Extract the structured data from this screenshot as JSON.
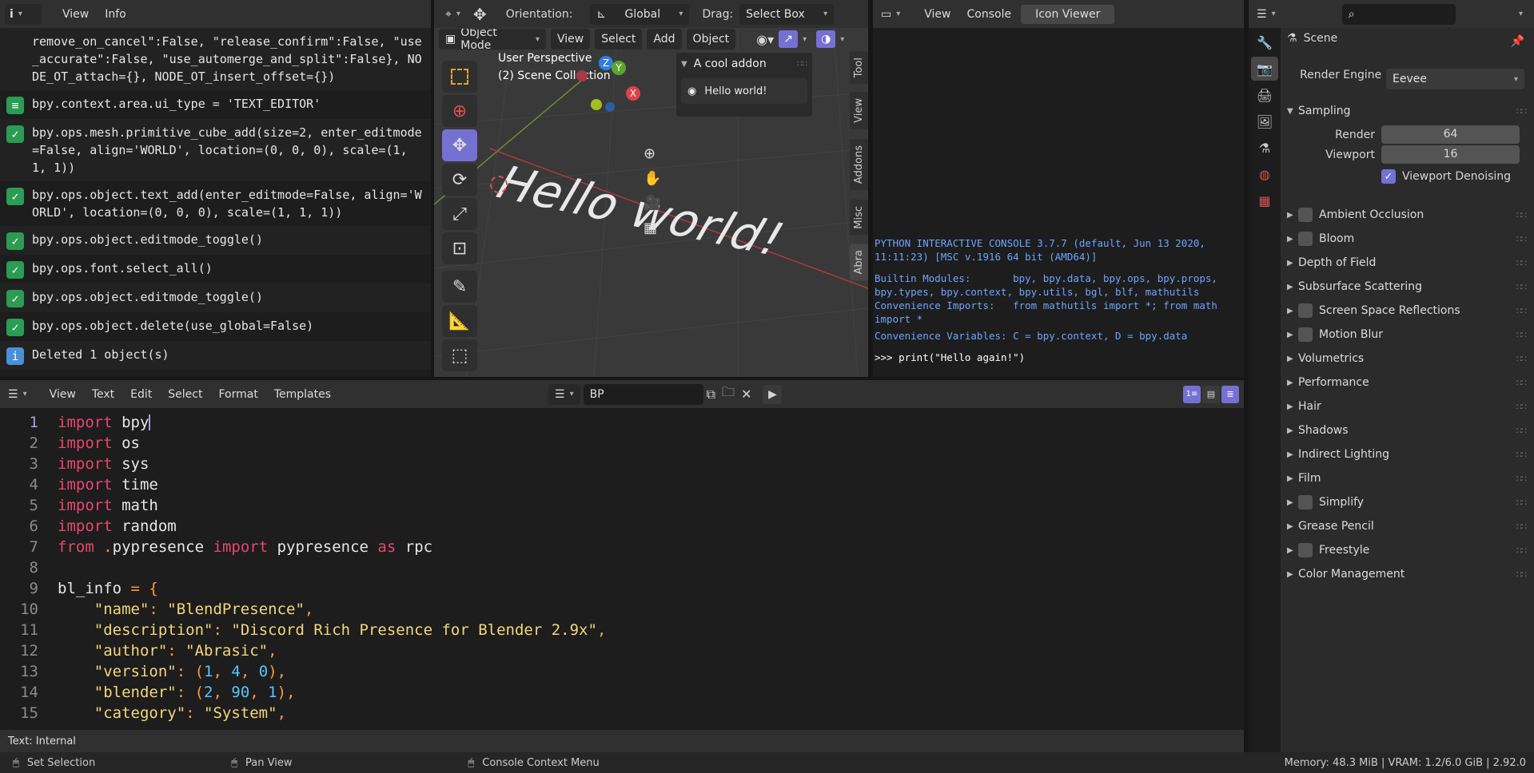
{
  "info": {
    "menus": [
      "View",
      "Info"
    ],
    "entries": [
      {
        "badge": "",
        "text": "remove_on_cancel\":False, \"release_confirm\":False, \"use_accurate\":False, \"use_automerge_and_split\":False}, NODE_OT_attach={}, NODE_OT_insert_offset={})"
      },
      {
        "badge": "props",
        "text": "bpy.context.area.ui_type = 'TEXT_EDITOR'"
      },
      {
        "badge": "op",
        "text": "bpy.ops.mesh.primitive_cube_add(size=2, enter_editmode=False, align='WORLD', location=(0, 0, 0), scale=(1, 1, 1))"
      },
      {
        "badge": "op",
        "text": "bpy.ops.object.text_add(enter_editmode=False, align='WORLD', location=(0, 0, 0), scale=(1, 1, 1))"
      },
      {
        "badge": "op",
        "text": "bpy.ops.object.editmode_toggle()"
      },
      {
        "badge": "op",
        "text": "bpy.ops.font.select_all()"
      },
      {
        "badge": "op",
        "text": "bpy.ops.object.editmode_toggle()"
      },
      {
        "badge": "op",
        "text": "bpy.ops.object.delete(use_global=False)"
      },
      {
        "badge": "info",
        "text": "Deleted 1 object(s)"
      }
    ]
  },
  "viewport": {
    "orientation_label": "Orientation:",
    "orientation_value": "Global",
    "drag_label": "Drag:",
    "drag_value": "Select Box",
    "mode": "Object Mode",
    "menus": [
      "View",
      "Select",
      "Add",
      "Object"
    ],
    "overlay_title": "User Perspective",
    "overlay_sub": "(2) Scene Collection",
    "scene_text": "Hello world!",
    "addon_panel": {
      "title": "A cool addon",
      "button": "Hello world!"
    },
    "side_tabs": [
      "Tool",
      "View",
      "Addons",
      "Misc",
      "Abra"
    ],
    "gizmo": {
      "x": "X",
      "y": "Y",
      "z": "Z"
    }
  },
  "console": {
    "menus": [
      "View",
      "Console",
      "Icon Viewer"
    ],
    "banner": "PYTHON INTERACTIVE CONSOLE 3.7.7 (default, Jun 13 2020, 11:11:23) [MSC v.1916 64 bit (AMD64)]",
    "builtin": "Builtin Modules:       bpy, bpy.data, bpy.ops, bpy.props, bpy.types, bpy.context, bpy.utils, bgl, blf, mathutils",
    "imports": "Convenience Imports:   from mathutils import *; from math import *",
    "vars": "Convenience Variables: C = bpy.context, D = bpy.data",
    "prompt": ">>> print(\"Hello again!\")"
  },
  "properties": {
    "search_placeholder": "",
    "scene_label": "Scene",
    "render_engine_label": "Render Engine",
    "render_engine_value": "Eevee",
    "sampling": "Sampling",
    "render_label": "Render",
    "render_value": "64",
    "viewport_label": "Viewport",
    "viewport_value": "16",
    "denoise": "Viewport Denoising",
    "panels": [
      {
        "label": "Ambient Occlusion",
        "check": true
      },
      {
        "label": "Bloom",
        "check": true
      },
      {
        "label": "Depth of Field",
        "check": false
      },
      {
        "label": "Subsurface Scattering",
        "check": false
      },
      {
        "label": "Screen Space Reflections",
        "check": true
      },
      {
        "label": "Motion Blur",
        "check": true
      },
      {
        "label": "Volumetrics",
        "check": false
      },
      {
        "label": "Performance",
        "check": false
      },
      {
        "label": "Hair",
        "check": false
      },
      {
        "label": "Shadows",
        "check": false
      },
      {
        "label": "Indirect Lighting",
        "check": false
      },
      {
        "label": "Film",
        "check": false
      },
      {
        "label": "Simplify",
        "check": true
      },
      {
        "label": "Grease Pencil",
        "check": false
      },
      {
        "label": "Freestyle",
        "check": true
      },
      {
        "label": "Color Management",
        "check": false
      }
    ]
  },
  "text_editor": {
    "menus": [
      "View",
      "Text",
      "Edit",
      "Select",
      "Format",
      "Templates"
    ],
    "text_name": "BP",
    "footer": "Text: Internal",
    "lines": [
      [
        [
          "kw",
          "import"
        ],
        [
          "df",
          " bpy"
        ]
      ],
      [
        [
          "kw",
          "import"
        ],
        [
          "df",
          " os"
        ]
      ],
      [
        [
          "kw",
          "import"
        ],
        [
          "df",
          " sys"
        ]
      ],
      [
        [
          "kw",
          "import"
        ],
        [
          "df",
          " time"
        ]
      ],
      [
        [
          "kw",
          "import"
        ],
        [
          "df",
          " math"
        ]
      ],
      [
        [
          "kw",
          "import"
        ],
        [
          "df",
          " random"
        ]
      ],
      [
        [
          "kw",
          "from"
        ],
        [
          "op",
          " ."
        ],
        [
          "df",
          "pypresence "
        ],
        [
          "kw",
          "import"
        ],
        [
          "df",
          " pypresence "
        ],
        [
          "kw",
          "as"
        ],
        [
          "df",
          " rpc"
        ]
      ],
      [
        [
          "df",
          ""
        ]
      ],
      [
        [
          "df",
          "bl_info "
        ],
        [
          "op",
          "="
        ],
        [
          "op",
          " {"
        ]
      ],
      [
        [
          "df",
          "    "
        ],
        [
          "st",
          "\"name\""
        ],
        [
          "op",
          ":"
        ],
        [
          "st",
          " \"BlendPresence\""
        ],
        [
          "op",
          ","
        ]
      ],
      [
        [
          "df",
          "    "
        ],
        [
          "st",
          "\"description\""
        ],
        [
          "op",
          ":"
        ],
        [
          "st",
          " \"Discord Rich Presence for Blender 2.9x\""
        ],
        [
          "op",
          ","
        ]
      ],
      [
        [
          "df",
          "    "
        ],
        [
          "st",
          "\"author\""
        ],
        [
          "op",
          ":"
        ],
        [
          "st",
          " \"Abrasic\""
        ],
        [
          "op",
          ","
        ]
      ],
      [
        [
          "df",
          "    "
        ],
        [
          "st",
          "\"version\""
        ],
        [
          "op",
          ": ("
        ],
        [
          "nm",
          "1"
        ],
        [
          "op",
          ", "
        ],
        [
          "nm",
          "4"
        ],
        [
          "op",
          ", "
        ],
        [
          "nm",
          "0"
        ],
        [
          "op",
          "),"
        ]
      ],
      [
        [
          "df",
          "    "
        ],
        [
          "st",
          "\"blender\""
        ],
        [
          "op",
          ": ("
        ],
        [
          "nm",
          "2"
        ],
        [
          "op",
          ", "
        ],
        [
          "nm",
          "90"
        ],
        [
          "op",
          ", "
        ],
        [
          "nm",
          "1"
        ],
        [
          "op",
          "),"
        ]
      ],
      [
        [
          "df",
          "    "
        ],
        [
          "st",
          "\"category\""
        ],
        [
          "op",
          ":"
        ],
        [
          "st",
          " \"System\""
        ],
        [
          "op",
          ","
        ]
      ],
      [
        [
          "op",
          "}"
        ]
      ]
    ]
  },
  "status": {
    "left": "Set Selection",
    "mid": "Pan View",
    "right": "Console Context Menu",
    "memory": "Memory: 48.3 MiB | VRAM: 1.2/6.0 GiB | 2.92.0"
  }
}
